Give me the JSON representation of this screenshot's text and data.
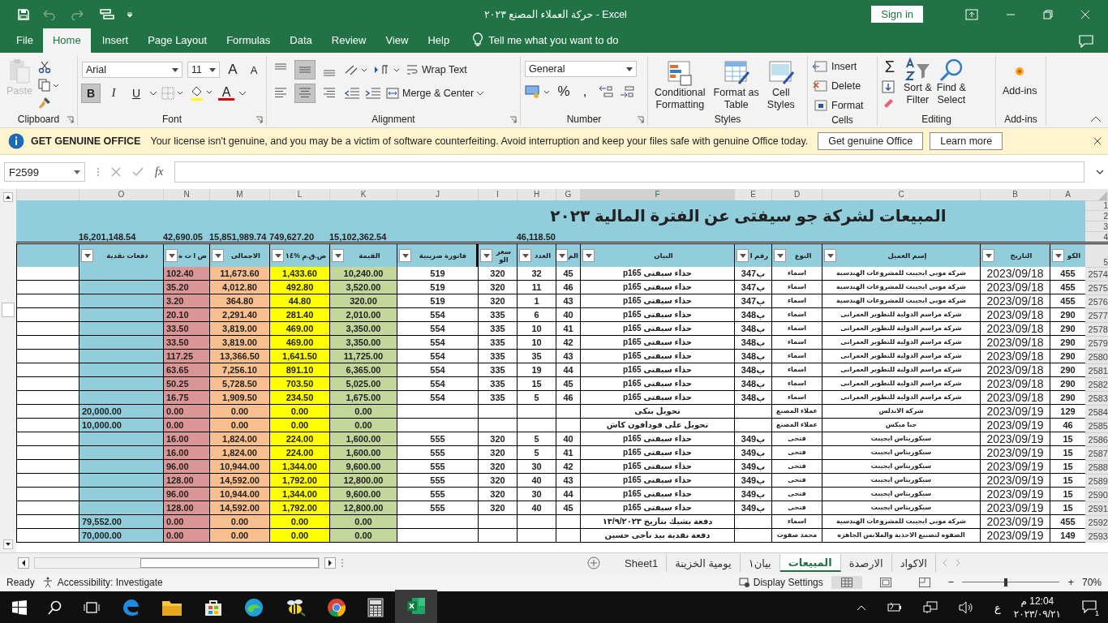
{
  "window": {
    "title": "حركة العملاء المصنع ٢٠٢٣  -  Excel",
    "sign_in": "Sign in"
  },
  "menu_tabs": [
    {
      "label": "Help",
      "selected": false
    },
    {
      "label": "View",
      "selected": false
    },
    {
      "label": "Review",
      "selected": false
    },
    {
      "label": "Data",
      "selected": false
    },
    {
      "label": "Formulas",
      "selected": false
    },
    {
      "label": "Page Layout",
      "selected": false
    },
    {
      "label": "Insert",
      "selected": false
    },
    {
      "label": "Home",
      "selected": true
    },
    {
      "label": "File",
      "selected": false
    }
  ],
  "tell_me": "Tell me what you want to do",
  "ribbon": {
    "clipboard": {
      "paste": "Paste",
      "paste_disabled": true,
      "label": "Clipboard"
    },
    "font": {
      "name": "Arial",
      "size": "11",
      "grow": "A",
      "shrink": "A",
      "color_letter": "A",
      "label": "Font",
      "styles": [
        {
          "label": "U",
          "selected": false
        },
        {
          "label": "I",
          "selected": false
        },
        {
          "label": "B",
          "selected": true
        }
      ]
    },
    "alignment": {
      "vertical": [
        {
          "selected": false
        },
        {
          "selected": true
        },
        {
          "selected": false
        }
      ],
      "horizontal": [
        {
          "selected": false
        },
        {
          "selected": true
        },
        {
          "selected": false
        }
      ],
      "wrap": "Wrap Text",
      "merge": "Merge & Center",
      "label": "Alignment"
    },
    "number": {
      "format": "General",
      "percent": "%",
      "comma": ",",
      "label": "Number"
    },
    "styles": {
      "buttons": [
        [
          "Cell",
          "Styles"
        ],
        [
          "Format as",
          "Table"
        ],
        [
          "Conditional",
          "Formatting"
        ]
      ],
      "label": "Styles"
    },
    "cells": {
      "buttons": [
        "Insert",
        "Delete",
        "Format"
      ],
      "label": "Cells"
    },
    "editing": {
      "sum": "Σ",
      "buttons": [
        [
          "Find &",
          "Select"
        ],
        [
          "Sort &",
          "Filter"
        ]
      ],
      "label": "Editing"
    },
    "addins": {
      "button": "Add-ins",
      "label": "Add-ins"
    }
  },
  "message_bar": {
    "title": "GET GENUINE OFFICE",
    "text": "Your license isn't genuine, and you may be a victim of software counterfeiting. Avoid interruption and keep your files safe with genuine Office today.",
    "buttons": [
      "Learn more",
      "Get genuine Office"
    ]
  },
  "formula_bar": {
    "name_box": "F2599",
    "fx": "fx"
  },
  "sheet": {
    "columns": [
      {
        "letter": "A",
        "header": "الكو",
        "selected": false
      },
      {
        "letter": "B",
        "header": "التاريخ",
        "selected": false
      },
      {
        "letter": "C",
        "header": "إسم العميل",
        "selected": false
      },
      {
        "letter": "D",
        "header": "النوع",
        "selected": false
      },
      {
        "letter": "E",
        "header": "رقم ا",
        "selected": false
      },
      {
        "letter": "F",
        "header": "البيان",
        "selected": true
      },
      {
        "letter": "G",
        "header": "الم",
        "selected": false
      },
      {
        "letter": "H",
        "header": "العدد",
        "selected": false
      },
      {
        "letter": "I",
        "header": "سعر الو",
        "selected": false
      },
      {
        "letter": "J",
        "header": "فاتورة ضريبية",
        "selected": false
      },
      {
        "letter": "K",
        "header": "القيمة",
        "selected": false,
        "color": "#c4d79b"
      },
      {
        "letter": "L",
        "header": "ض.ق.م %١٤",
        "selected": false,
        "color": "#ffff00"
      },
      {
        "letter": "M",
        "header": "الاجمالى",
        "selected": false,
        "color": "#fabf8f"
      },
      {
        "letter": "N",
        "header": "ض ا ت ه",
        "selected": false,
        "color": "#da9694"
      },
      {
        "letter": "O",
        "header": "دفعات نقدية",
        "selected": false,
        "color": "#92cddc"
      }
    ],
    "top_rows": [
      "1",
      "2",
      "3",
      "4"
    ],
    "header_row": "5",
    "title": "المبيعات لشركة جو سيفتى عن الفترة المالية ٢٠٢٣",
    "totals": {
      "H": "46,118.50",
      "K": "15,102,362.54",
      "L": "749,627.20",
      "M": "15,851,989.74",
      "N": "42,690.05",
      "O": "16,201,148.54"
    },
    "rows": [
      {
        "number": "2574",
        "cells": {
          "A": "455",
          "B": "2023/09/18",
          "C": "شركة موبي ايجيبت للمشروعات الهندسية",
          "D": "اسماء",
          "E": "ب347",
          "F": "حذاء سيفتى p165",
          "G": "45",
          "H": "32",
          "I": "320",
          "J": "519",
          "K": "10,240.00",
          "L": "1,433.60",
          "M": "11,673.60",
          "N": "102.40"
        }
      },
      {
        "number": "2575",
        "cells": {
          "A": "455",
          "B": "2023/09/18",
          "C": "شركة موبي ايجيبت للمشروعات الهندسية",
          "D": "اسماء",
          "E": "ب347",
          "F": "حذاء سيفتى p165",
          "G": "46",
          "H": "11",
          "I": "320",
          "J": "519",
          "K": "3,520.00",
          "L": "492.80",
          "M": "4,012.80",
          "N": "35.20"
        }
      },
      {
        "number": "2576",
        "cells": {
          "A": "455",
          "B": "2023/09/18",
          "C": "شركة موبي ايجيبت للمشروعات الهندسية",
          "D": "اسماء",
          "E": "ب347",
          "F": "حذاء سيفتى p165",
          "G": "43",
          "H": "1",
          "I": "320",
          "J": "519",
          "K": "320.00",
          "L": "44.80",
          "M": "364.80",
          "N": "3.20"
        }
      },
      {
        "number": "2577",
        "cells": {
          "A": "290",
          "B": "2023/09/18",
          "C": "شركة مراسم الدولية للتطوير العمرانى",
          "D": "اسماء",
          "E": "ب348",
          "F": "حذاء سيفتى p165",
          "G": "40",
          "H": "6",
          "I": "335",
          "J": "554",
          "K": "2,010.00",
          "L": "281.40",
          "M": "2,291.40",
          "N": "20.10"
        }
      },
      {
        "number": "2578",
        "cells": {
          "A": "290",
          "B": "2023/09/18",
          "C": "شركة مراسم الدولية للتطوير العمرانى",
          "D": "اسماء",
          "E": "ب348",
          "F": "حذاء سيفتى p165",
          "G": "41",
          "H": "10",
          "I": "335",
          "J": "554",
          "K": "3,350.00",
          "L": "469.00",
          "M": "3,819.00",
          "N": "33.50"
        }
      },
      {
        "number": "2579",
        "cells": {
          "A": "290",
          "B": "2023/09/18",
          "C": "شركة مراسم الدولية للتطوير العمرانى",
          "D": "اسماء",
          "E": "ب348",
          "F": "حذاء سيفتى p165",
          "G": "42",
          "H": "10",
          "I": "335",
          "J": "554",
          "K": "3,350.00",
          "L": "469.00",
          "M": "3,819.00",
          "N": "33.50"
        }
      },
      {
        "number": "2580",
        "cells": {
          "A": "290",
          "B": "2023/09/18",
          "C": "شركة مراسم الدولية للتطوير العمرانى",
          "D": "اسماء",
          "E": "ب348",
          "F": "حذاء سيفتى p165",
          "G": "43",
          "H": "35",
          "I": "335",
          "J": "554",
          "K": "11,725.00",
          "L": "1,641.50",
          "M": "13,366.50",
          "N": "117.25"
        }
      },
      {
        "number": "2581",
        "cells": {
          "A": "290",
          "B": "2023/09/18",
          "C": "شركة مراسم الدولية للتطوير العمرانى",
          "D": "اسماء",
          "E": "ب348",
          "F": "حذاء سيفتى p165",
          "G": "44",
          "H": "19",
          "I": "335",
          "J": "554",
          "K": "6,365.00",
          "L": "891.10",
          "M": "7,256.10",
          "N": "63.65"
        }
      },
      {
        "number": "2582",
        "cells": {
          "A": "290",
          "B": "2023/09/18",
          "C": "شركة مراسم الدولية للتطوير العمرانى",
          "D": "اسماء",
          "E": "ب348",
          "F": "حذاء سيفتى p165",
          "G": "45",
          "H": "15",
          "I": "335",
          "J": "554",
          "K": "5,025.00",
          "L": "703.50",
          "M": "5,728.50",
          "N": "50.25"
        }
      },
      {
        "number": "2583",
        "cells": {
          "A": "290",
          "B": "2023/09/18",
          "C": "شركة مراسم الدولية للتطوير العمرانى",
          "D": "اسماء",
          "E": "ب348",
          "F": "حذاء سيفتى p165",
          "G": "46",
          "H": "5",
          "I": "335",
          "J": "554",
          "K": "1,675.00",
          "L": "234.50",
          "M": "1,909.50",
          "N": "16.75"
        }
      },
      {
        "number": "2584",
        "cells": {
          "A": "129",
          "B": "2023/09/19",
          "C": "شركة الاندلس",
          "D": "عملاء المصنع",
          "F": "تحويل بنكى",
          "K": "0.00",
          "L": "0.00",
          "M": "0.00",
          "N": "0.00",
          "O": "20,000.00"
        }
      },
      {
        "number": "2585",
        "cells": {
          "A": "46",
          "B": "2023/09/19",
          "C": "جنا ميكس",
          "D": "عملاء المصنع",
          "F": "تحويل على فودافون كاش",
          "K": "0.00",
          "L": "0.00",
          "M": "0.00",
          "N": "0.00",
          "O": "10,000.00"
        }
      },
      {
        "number": "2586",
        "cells": {
          "A": "15",
          "B": "2023/09/19",
          "C": "سيكوريتاس ايجيبت",
          "D": "فتحى",
          "E": "ب349",
          "F": "حذاء سيفتى p165",
          "G": "40",
          "H": "5",
          "I": "320",
          "J": "555",
          "K": "1,600.00",
          "L": "224.00",
          "M": "1,824.00",
          "N": "16.00"
        }
      },
      {
        "number": "2587",
        "cells": {
          "A": "15",
          "B": "2023/09/19",
          "C": "سيكوريتاس ايجيبت",
          "D": "فتحى",
          "E": "ب349",
          "F": "حذاء سيفتى p165",
          "G": "41",
          "H": "5",
          "I": "320",
          "J": "555",
          "K": "1,600.00",
          "L": "224.00",
          "M": "1,824.00",
          "N": "16.00"
        }
      },
      {
        "number": "2588",
        "cells": {
          "A": "15",
          "B": "2023/09/19",
          "C": "سيكوريتاس ايجيبت",
          "D": "فتحى",
          "E": "ب349",
          "F": "حذاء سيفتى p165",
          "G": "42",
          "H": "30",
          "I": "320",
          "J": "555",
          "K": "9,600.00",
          "L": "1,344.00",
          "M": "10,944.00",
          "N": "96.00"
        }
      },
      {
        "number": "2589",
        "cells": {
          "A": "15",
          "B": "2023/09/19",
          "C": "سيكوريتاس ايجيبت",
          "D": "فتحى",
          "E": "ب349",
          "F": "حذاء سيفتى p165",
          "G": "43",
          "H": "40",
          "I": "320",
          "J": "555",
          "K": "12,800.00",
          "L": "1,792.00",
          "M": "14,592.00",
          "N": "128.00"
        }
      },
      {
        "number": "2590",
        "cells": {
          "A": "15",
          "B": "2023/09/19",
          "C": "سيكوريتاس ايجيبت",
          "D": "فتحى",
          "E": "ب349",
          "F": "حذاء سيفتى p165",
          "G": "44",
          "H": "30",
          "I": "320",
          "J": "555",
          "K": "9,600.00",
          "L": "1,344.00",
          "M": "10,944.00",
          "N": "96.00"
        }
      },
      {
        "number": "2591",
        "cells": {
          "A": "15",
          "B": "2023/09/19",
          "C": "سيكوريتاس ايجيبت",
          "D": "فتحى",
          "E": "ب349",
          "F": "حذاء سيفتى p165",
          "G": "45",
          "H": "40",
          "I": "320",
          "J": "555",
          "K": "12,800.00",
          "L": "1,792.00",
          "M": "14,592.00",
          "N": "128.00"
        }
      },
      {
        "number": "2592",
        "cells": {
          "A": "455",
          "B": "2023/09/19",
          "C": "شركة موبي ايجيبت للمشروعات الهندسية",
          "D": "اسماء",
          "F": "دفعة بشيك بتاريخ ١٣/٩/٢٠٢٣",
          "K": "0.00",
          "L": "0.00",
          "M": "0.00",
          "N": "0.00",
          "O": "79,552.00"
        }
      },
      {
        "number": "2593",
        "cells": {
          "A": "149",
          "B": "2023/09/19",
          "C": "الصفوه لتصنيع الاحذية والملابس الجاهزه",
          "D": "محمد صفوت",
          "F": "دفعة نقدية بيد ناجى حسين",
          "K": "0.00",
          "L": "0.00",
          "M": "0.00",
          "N": "0.00",
          "O": "70,000.00"
        }
      }
    ]
  },
  "sheet_tabs": [
    {
      "label": "الاكواد",
      "selected": false
    },
    {
      "label": "الارصدة",
      "selected": false
    },
    {
      "label": "المبيعات",
      "selected": true
    },
    {
      "label": "بيان١",
      "selected": false
    },
    {
      "label": "يومية الخزينة",
      "selected": false
    },
    {
      "label": "Sheet1",
      "selected": false
    }
  ],
  "status_bar": {
    "ready": "Ready",
    "accessibility": "Accessibility: Investigate",
    "display": "Display Settings",
    "zoom": "70%",
    "zoom_out": "−",
    "zoom_in": "+",
    "zoom_level": {
      "level": 0.45
    }
  },
  "taskbar": {
    "language": "ع",
    "time": "12:04 م",
    "date": "٢٠٢٣/٠٩/٢١",
    "notifications": "1"
  }
}
